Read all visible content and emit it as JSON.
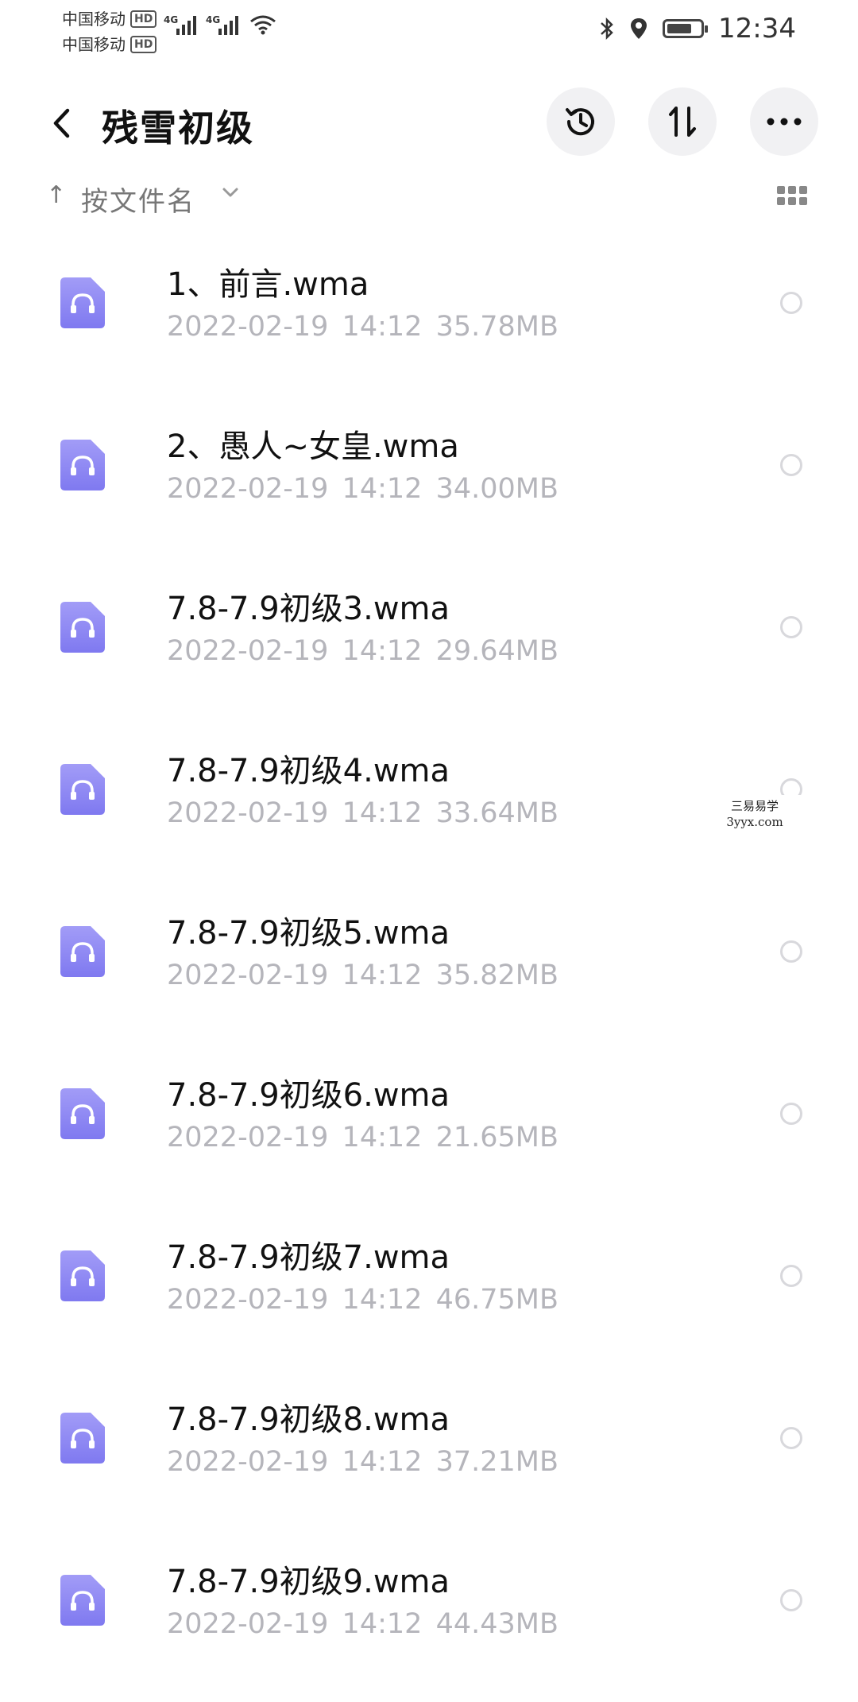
{
  "status_bar": {
    "carrier_1": "中国移动",
    "carrier_2": "中国移动",
    "hd_badge": "HD",
    "network_type": "4G",
    "time": "12:34",
    "battery_level": 0.75
  },
  "header": {
    "title": "残雪初级"
  },
  "sort_bar": {
    "label": "按文件名",
    "direction_symbol": "↑"
  },
  "files": [
    {
      "name": "1、前言.wma",
      "date": "2022-02-19",
      "time": "14:12",
      "size": "35.78MB"
    },
    {
      "name": "2、愚人~女皇.wma",
      "date": "2022-02-19",
      "time": "14:12",
      "size": "34.00MB"
    },
    {
      "name": "7.8-7.9初级3.wma",
      "date": "2022-02-19",
      "time": "14:12",
      "size": "29.64MB"
    },
    {
      "name": "7.8-7.9初级4.wma",
      "date": "2022-02-19",
      "time": "14:12",
      "size": "33.64MB"
    },
    {
      "name": "7.8-7.9初级5.wma",
      "date": "2022-02-19",
      "time": "14:12",
      "size": "35.82MB"
    },
    {
      "name": "7.8-7.9初级6.wma",
      "date": "2022-02-19",
      "time": "14:12",
      "size": "21.65MB"
    },
    {
      "name": "7.8-7.9初级7.wma",
      "date": "2022-02-19",
      "time": "14:12",
      "size": "46.75MB"
    },
    {
      "name": "7.8-7.9初级8.wma",
      "date": "2022-02-19",
      "time": "14:12",
      "size": "37.21MB"
    },
    {
      "name": "7.8-7.9初级9.wma",
      "date": "2022-02-19",
      "time": "14:12",
      "size": "44.43MB"
    }
  ],
  "watermark": {
    "line1": "三易易学",
    "line2": "3yyx.com"
  },
  "colors": {
    "accent_icon": "#8b86f5",
    "meta_text": "#b5b5bb",
    "button_bg": "#f1f1f3"
  },
  "icons": {
    "back": "chevron-left-icon",
    "history": "history-icon",
    "sort": "sort-updown-icon",
    "more": "more-icon",
    "grid": "grid-view-icon",
    "file": "audio-file-icon"
  }
}
